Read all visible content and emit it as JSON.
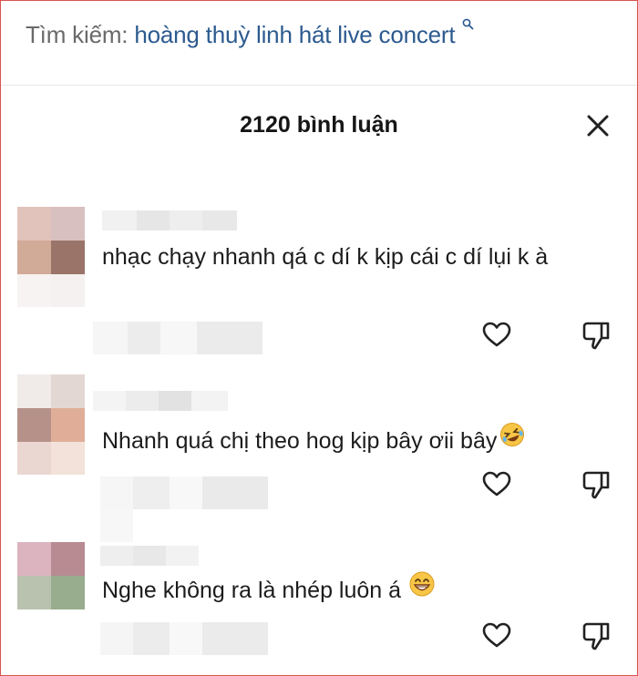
{
  "search": {
    "prefix": "Tìm kiếm:",
    "query": "hoàng thuỳ linh hát live concert",
    "icon": "search-icon"
  },
  "comments_panel": {
    "title": "2120 bình luận",
    "close_icon": "close-icon"
  },
  "comments": [
    {
      "text": "nhạc chạy nhanh qá c dí k kịp cái c dí lụi k à",
      "emoji": "",
      "avatar_colors": [
        "#e2c3bb",
        "#d9c0c0",
        "#d2aa98",
        "#9a7468",
        "#f7f3f2",
        "#f4f1f0"
      ]
    },
    {
      "text": "Nhanh quá chị theo hog kịp bây ơii bây",
      "emoji": "rofl-emoji",
      "avatar_colors": [
        "#f0ebe8",
        "#e3d7d3",
        "#b6918a",
        "#e0ae98",
        "#ead7d2",
        "#f3e2da"
      ]
    },
    {
      "text": "Nghe không ra là nhép luôn á",
      "emoji": "grin-emoji",
      "avatar_colors": [
        "#dcb4bf",
        "#b88b92",
        "#b9c2af",
        "#98ac8e",
        "#ffffff",
        "#ffffff"
      ]
    }
  ],
  "icons": {
    "like": "heart-icon",
    "dislike": "thumbs-down-icon"
  },
  "colors": {
    "query_link": "#2c5a8f",
    "title_text": "#161616",
    "comment_text": "#1c1c1c",
    "frame_border": "#d9534f"
  }
}
